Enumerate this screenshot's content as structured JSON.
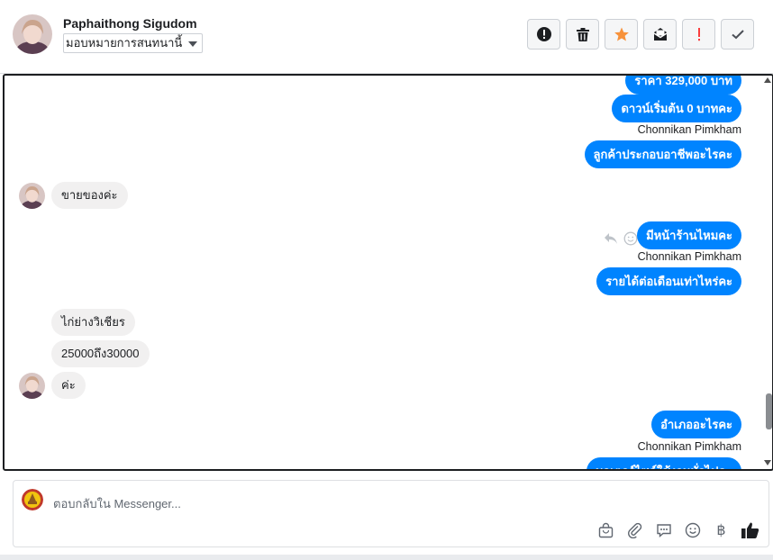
{
  "header": {
    "contact_name": "Paphaithong Sigudom",
    "assign_label": "มอบหมายการสนทนานี้",
    "actions": [
      {
        "name": "spam-button",
        "icon": "alert-circle-icon"
      },
      {
        "name": "delete-button",
        "icon": "trash-icon"
      },
      {
        "name": "star-button",
        "icon": "star-icon",
        "color": "#f7923b"
      },
      {
        "name": "mark-unread-button",
        "icon": "envelope-icon"
      },
      {
        "name": "follow-up-button",
        "icon": "exclamation-icon",
        "color": "#fa3e3e"
      },
      {
        "name": "done-button",
        "icon": "check-icon"
      }
    ]
  },
  "thread": {
    "messages": [
      {
        "direction": "out",
        "text": "ราคา 329,000 บาท"
      },
      {
        "direction": "out",
        "text": "ดาวน์เริ่มต้น 0 บาทคะ"
      },
      {
        "direction": "out",
        "sender": "Chonnikan Pimkham",
        "text": "ลูกค้าประกอบอาชีพอะไรคะ"
      },
      {
        "direction": "in",
        "text": "ขายของค่ะ"
      },
      {
        "direction": "out",
        "text": "มีหน้าร้านไหมคะ"
      },
      {
        "direction": "out",
        "sender": "Chonnikan Pimkham",
        "text": "รายได้ต่อเดือนเท่าไหร่คะ"
      },
      {
        "direction": "in",
        "text": "ไก่ย่างวิเชียร"
      },
      {
        "direction": "in",
        "text": "25000ถึง30000"
      },
      {
        "direction": "in",
        "text": "ค่ะ"
      },
      {
        "direction": "out",
        "text": "อำเภออะไรคะ"
      },
      {
        "direction": "out",
        "sender": "Chonnikan Pimkham",
        "text": "มอเตอร์ไซค์ใช้งานทั่วไปคะ"
      }
    ]
  },
  "composer": {
    "placeholder": "ตอบกลับใน Messenger..."
  },
  "colors": {
    "outgoing_bubble": "#0084ff",
    "incoming_bubble": "#f1f0f0",
    "like_icon": "#1c1e21"
  }
}
